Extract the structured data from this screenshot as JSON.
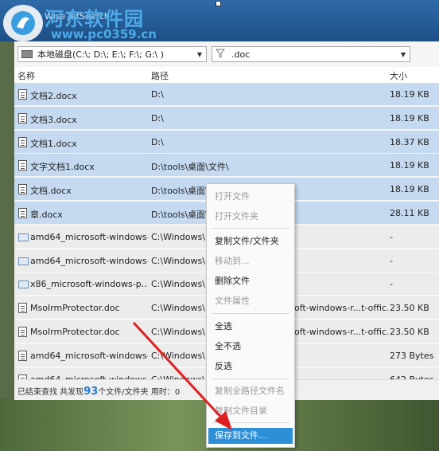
{
  "watermark": {
    "text": "河东软件园",
    "url": "www.pc0359.cn"
  },
  "app": {
    "title": "Wise JetSearch"
  },
  "toolbar": {
    "drive": "本地磁盘(C:\\; D:\\; E:\\; F:\\; G:\\ )",
    "filter": ".doc",
    "dropdown_glyph": "▼"
  },
  "columns": {
    "name": "名称",
    "path": "路径",
    "size": "大小"
  },
  "rows": [
    {
      "name": "文档2.docx",
      "path": "D:\\",
      "size": "18.19 KB"
    },
    {
      "name": "文档3.docx",
      "path": "D:\\",
      "size": "18.19 KB"
    },
    {
      "name": "文档1.docx",
      "path": "D:\\",
      "size": "18.37 KB"
    },
    {
      "name": "文字文档1.docx",
      "path": "D:\\tools\\桌面\\文件\\",
      "size": "18.19 KB"
    },
    {
      "name": "文档.docx",
      "path": "D:\\tools\\桌面\\",
      "size": "18.19 KB"
    },
    {
      "name": "章.docx",
      "path": "D:\\tools\\桌面\\",
      "size": "28.11 KB"
    },
    {
      "name": "amd64_microsoft-windows-p...",
      "path": "C:\\Windows\\",
      "size": "-"
    },
    {
      "name": "amd64_microsoft-windows-s...",
      "path": "C:\\Windows\\",
      "size": "-"
    },
    {
      "name": "x86_microsoft-windows-p...do",
      "path": "C:\\Windows\\",
      "size": "-"
    },
    {
      "name": "MsoIrmProtector.doc",
      "path": "C:\\Windows\\",
      "path_tail": "oft-windows-r...t-offic...",
      "size": "23.50 KB"
    },
    {
      "name": "MsoIrmProtector.doc",
      "path": "C:\\Windows\\",
      "path_tail": "oft-windows-r...t-offic...",
      "size": "23.50 KB"
    },
    {
      "name": "amd64_microsoft-windows-...",
      "path": "C:\\Windows\\",
      "size": "273 Bytes"
    },
    {
      "name": "amd64_microsoft-windows-...",
      "path": "C:\\Windows\\",
      "size": "642 Bytes"
    }
  ],
  "status": {
    "prefix": "已结束查找  共发现",
    "count": "93",
    "suffix": "个文件/文件夹   用时：",
    "time": "0"
  },
  "context_menu": {
    "open_file": "打开文件",
    "open_folder": "打开文件夹",
    "copy_file": "复制文件/文件夹",
    "move_to": "移动到...",
    "delete_file": "删除文件",
    "file_properties": "文件属性",
    "select_all": "全选",
    "select_none": "全不选",
    "invert": "反选",
    "copy_full_path": "复制全路径文件名",
    "copy_dir": "复制文件目录",
    "save_to_file": "保存到文件..."
  },
  "colors": {
    "selection": "#c5daf1",
    "highlight": "#2d8fd8",
    "arrow": "#e02020",
    "count": "#1e7bd8"
  }
}
